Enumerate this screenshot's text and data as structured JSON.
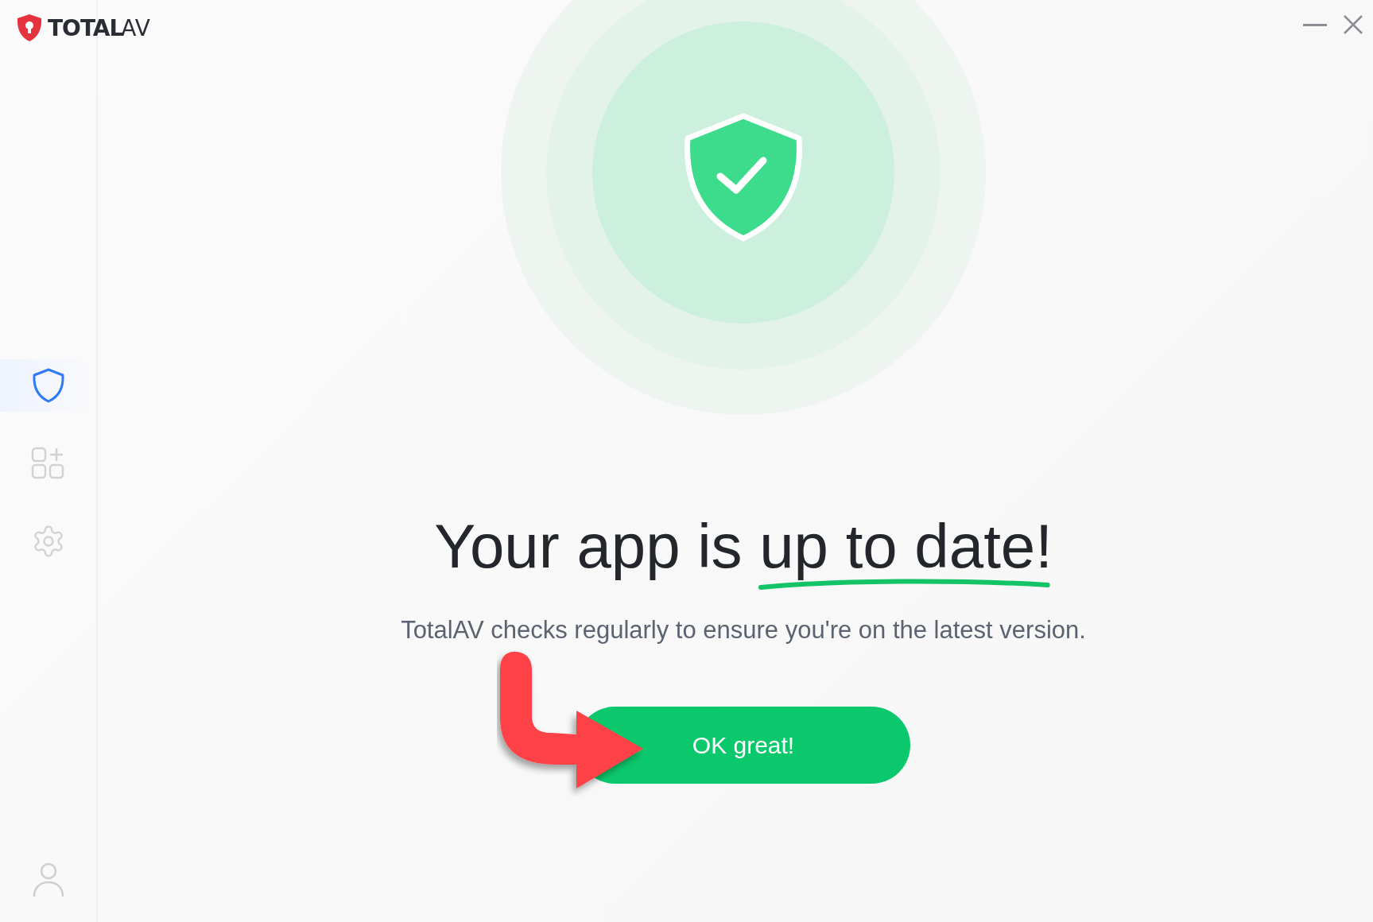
{
  "logo": {
    "bold": "TOTAL",
    "light": "AV"
  },
  "sidebar": {
    "items": [
      {
        "kind": "shield",
        "selected": true
      },
      {
        "kind": "apps",
        "selected": false
      },
      {
        "kind": "settings",
        "selected": false
      }
    ]
  },
  "heading": {
    "text": "Your app is ",
    "highlight": "up to date!"
  },
  "subtitle": "TotalAV checks regularly to ensure you're on the latest version.",
  "button": "OK great!"
}
